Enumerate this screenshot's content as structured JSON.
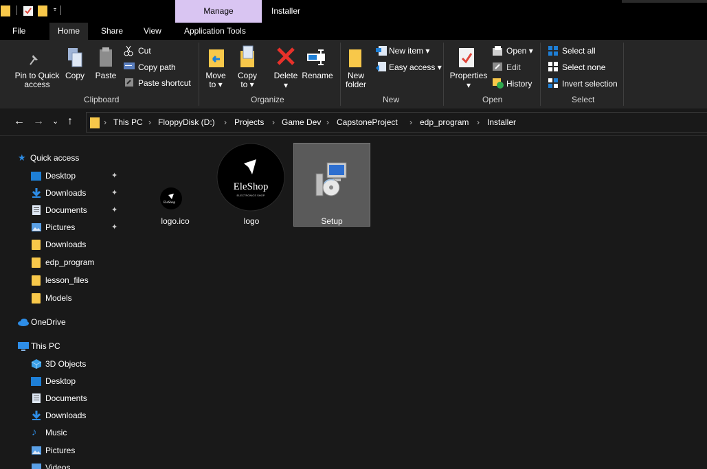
{
  "titlebar": {
    "context_tab": "Manage",
    "window_title": "Installer"
  },
  "tabs": {
    "file": "File",
    "home": "Home",
    "share": "Share",
    "view": "View",
    "app_tools": "Application Tools"
  },
  "ribbon": {
    "clipboard": {
      "pin_line1": "Pin to Quick",
      "pin_line2": "access",
      "copy": "Copy",
      "paste": "Paste",
      "cut": "Cut",
      "copy_path": "Copy path",
      "paste_shortcut": "Paste shortcut",
      "label": "Clipboard"
    },
    "organize": {
      "move_line1": "Move",
      "move_line2": "to ▾",
      "copy_line1": "Copy",
      "copy_line2": "to ▾",
      "delete": "Delete",
      "delete_arrow": "▾",
      "rename": "Rename",
      "label": "Organize"
    },
    "new": {
      "new_item": "New item ▾",
      "easy_access": "Easy access ▾",
      "new_folder_line1": "New",
      "new_folder_line2": "folder",
      "label": "New"
    },
    "open": {
      "properties": "Properties",
      "properties_arrow": "▾",
      "open": "Open ▾",
      "edit": "Edit",
      "history": "History",
      "label": "Open"
    },
    "select": {
      "select_all": "Select all",
      "select_none": "Select none",
      "invert_selection": "Invert selection",
      "label": "Select"
    }
  },
  "address": {
    "crumbs": [
      "This PC",
      "FloppyDisk (D:)",
      "Projects",
      "Game Dev",
      "CapstoneProject",
      "edp_program",
      "Installer"
    ]
  },
  "navpane": {
    "quick_access": "Quick access",
    "qa_items": [
      "Desktop",
      "Downloads",
      "Documents",
      "Pictures",
      "Downloads",
      "edp_program",
      "lesson_files",
      "Models"
    ],
    "onedrive": "OneDrive",
    "this_pc": "This PC",
    "pc_items": [
      "3D Objects",
      "Desktop",
      "Documents",
      "Downloads",
      "Music",
      "Pictures",
      "Videos"
    ]
  },
  "files": [
    {
      "name": "logo.ico",
      "logo_text": "EleShop"
    },
    {
      "name": "logo",
      "logo_text": "EleShop",
      "logo_sub": "ELECTRONICS SHOP"
    },
    {
      "name": "Setup"
    }
  ],
  "colors": {
    "folder": "#f8c84a",
    "accent_blue": "#1e7fd6",
    "context_tab": "#d9c5f2",
    "selection": "#5a5a5a"
  }
}
